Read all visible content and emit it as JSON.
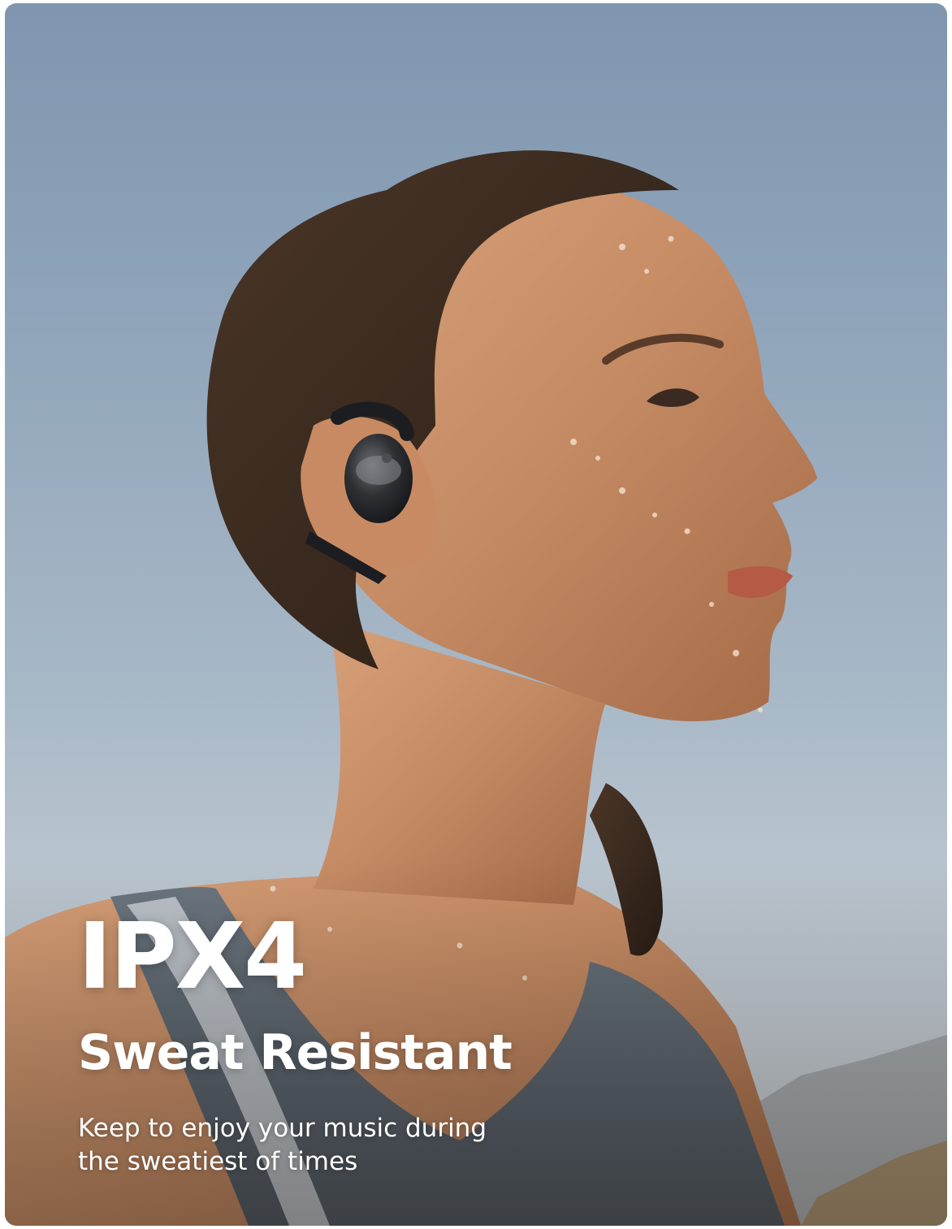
{
  "headline": "IPX4",
  "subheadline": "Sweat Resistant",
  "description_lines": [
    "Keep to enjoy your music during",
    "the sweatiest of times"
  ],
  "colors": {
    "sky_top": "#7f96ae",
    "sky_bottom": "#cfd3d6",
    "skin": "#c48a63",
    "hair": "#3a2a20",
    "tank_top": "#5c6670",
    "earbud": "#2a2b2e",
    "text": "#ffffff"
  },
  "scene": {
    "subject": "woman-in-profile",
    "product": "open-ear-earbud"
  }
}
